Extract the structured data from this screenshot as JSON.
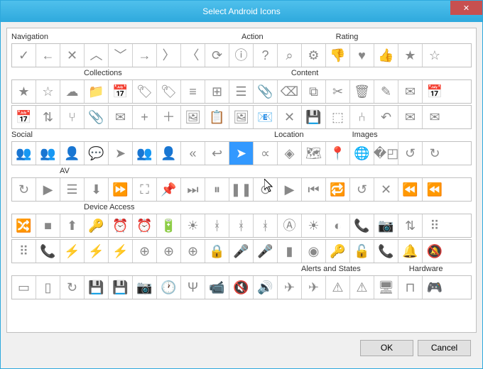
{
  "window": {
    "title": "Select Android Icons"
  },
  "buttons": {
    "ok": "OK",
    "cancel": "Cancel",
    "close": "✕"
  },
  "selected_icon": "social-send",
  "categories": [
    {
      "row": 0,
      "pos": 0,
      "label": "Navigation"
    },
    {
      "row": 0,
      "pos": 10,
      "label": "Action"
    },
    {
      "row": 0,
      "pos": 15,
      "label": "Rating"
    },
    {
      "row": 1,
      "pos": 3,
      "label": "Collections"
    },
    {
      "row": 1,
      "pos": 12,
      "label": "Content"
    },
    {
      "row": 3,
      "pos": 0,
      "label": "Social"
    },
    {
      "row": 3,
      "pos": 12,
      "label": "Location"
    },
    {
      "row": 3,
      "pos": 16,
      "label": "Images"
    },
    {
      "row": 4,
      "pos": 2,
      "label": "AV"
    },
    {
      "row": 5,
      "pos": 3,
      "label": "Device Access"
    },
    {
      "row": 7,
      "pos": 12,
      "label": "Alerts and States"
    },
    {
      "row": 7,
      "pos": 17,
      "label": "Hardware"
    }
  ],
  "rows": [
    [
      {
        "n": "nav-accept",
        "g": "✓"
      },
      {
        "n": "nav-back",
        "g": "←"
      },
      {
        "n": "nav-cancel",
        "g": "✕"
      },
      {
        "n": "nav-collapse",
        "g": "︿"
      },
      {
        "n": "nav-expand",
        "g": "﹀"
      },
      {
        "n": "nav-forward",
        "g": "→"
      },
      {
        "n": "nav-next",
        "g": "〉"
      },
      {
        "n": "nav-previous",
        "g": "〈"
      },
      {
        "n": "nav-refresh",
        "g": "⟳"
      },
      {
        "n": "action-about",
        "g": "ⓘ"
      },
      {
        "n": "action-help",
        "g": "?"
      },
      {
        "n": "action-search",
        "g": "⌕"
      },
      {
        "n": "action-settings",
        "g": "⚙"
      },
      {
        "n": "rating-bad",
        "g": "👎"
      },
      {
        "n": "rating-favorite",
        "g": "♥"
      },
      {
        "n": "rating-good",
        "g": "👍"
      },
      {
        "n": "rating-important",
        "g": "★"
      },
      {
        "n": "rating-half",
        "g": "☆"
      }
    ],
    [
      {
        "n": "rating-important2",
        "g": "★"
      },
      {
        "n": "rating-not-important",
        "g": "☆"
      },
      {
        "n": "collections-cloud",
        "g": "☁"
      },
      {
        "n": "collections-collection",
        "g": "📁"
      },
      {
        "n": "collections-go-today",
        "g": "📅"
      },
      {
        "n": "collections-labels",
        "g": "🏷"
      },
      {
        "n": "collections-new-label",
        "g": "🏷"
      },
      {
        "n": "collections-sort",
        "g": "≡"
      },
      {
        "n": "collections-view-grid",
        "g": "⊞"
      },
      {
        "n": "collections-view-list",
        "g": "☰"
      },
      {
        "n": "content-attachment",
        "g": "📎"
      },
      {
        "n": "content-backspace",
        "g": "⌫"
      },
      {
        "n": "content-copy",
        "g": "⧉"
      },
      {
        "n": "content-cut",
        "g": "✂"
      },
      {
        "n": "content-discard",
        "g": "🗑"
      },
      {
        "n": "content-edit",
        "g": "✎"
      },
      {
        "n": "content-email",
        "g": "✉"
      },
      {
        "n": "content-event",
        "g": "📅"
      }
    ],
    [
      {
        "n": "content-event2",
        "g": "📅"
      },
      {
        "n": "content-import-export",
        "g": "⇅"
      },
      {
        "n": "content-merge",
        "g": "⑂"
      },
      {
        "n": "content-attachment2",
        "g": "📎"
      },
      {
        "n": "content-email2",
        "g": "✉"
      },
      {
        "n": "content-add-person",
        "g": "+"
      },
      {
        "n": "content-new",
        "g": "＋"
      },
      {
        "n": "content-picture",
        "g": "🖼"
      },
      {
        "n": "content-paste",
        "g": "📋"
      },
      {
        "n": "content-picture2",
        "g": "🖼"
      },
      {
        "n": "content-read",
        "g": "📧"
      },
      {
        "n": "content-remove",
        "g": "✕"
      },
      {
        "n": "content-save",
        "g": "💾"
      },
      {
        "n": "content-select-all",
        "g": "⬚"
      },
      {
        "n": "content-split",
        "g": "⑃"
      },
      {
        "n": "content-undo",
        "g": "↶"
      },
      {
        "n": "content-unread",
        "g": "✉"
      },
      {
        "n": "content-markread",
        "g": "✉"
      }
    ],
    [
      {
        "n": "social-group",
        "g": "👥"
      },
      {
        "n": "social-add-group",
        "g": "👥"
      },
      {
        "n": "social-person",
        "g": "👤"
      },
      {
        "n": "social-cc",
        "g": "💬"
      },
      {
        "n": "social-forward",
        "g": "➤"
      },
      {
        "n": "social-group2",
        "g": "👥"
      },
      {
        "n": "social-person2",
        "g": "👤"
      },
      {
        "n": "social-reply-all",
        "g": "«"
      },
      {
        "n": "social-reply",
        "g": "↩"
      },
      {
        "n": "social-send",
        "g": "➤"
      },
      {
        "n": "social-share",
        "g": "∝"
      },
      {
        "n": "location-directions",
        "g": "◈"
      },
      {
        "n": "location-map",
        "g": "🗺"
      },
      {
        "n": "location-place",
        "g": "📍"
      },
      {
        "n": "location-web",
        "g": "🌐"
      },
      {
        "n": "images-crop",
        "g": "�◰"
      },
      {
        "n": "images-rotate-left",
        "g": "↺"
      },
      {
        "n": "images-rotate-right",
        "g": "↻"
      }
    ],
    [
      {
        "n": "av-rotate",
        "g": "↻"
      },
      {
        "n": "av-slideshow",
        "g": "▶"
      },
      {
        "n": "av-queue",
        "g": "☰"
      },
      {
        "n": "av-download",
        "g": "⬇"
      },
      {
        "n": "av-ff",
        "g": "⏩"
      },
      {
        "n": "av-fullscreen",
        "g": "⛶"
      },
      {
        "n": "av-available",
        "g": "📌"
      },
      {
        "n": "av-next",
        "g": "⏭"
      },
      {
        "n": "av-pause2",
        "g": "⏸"
      },
      {
        "n": "av-pause",
        "g": "❚❚"
      },
      {
        "n": "av-play-circle",
        "g": "⊙"
      },
      {
        "n": "av-play",
        "g": "▶"
      },
      {
        "n": "av-previous",
        "g": "⏮"
      },
      {
        "n": "av-repeat",
        "g": "🔁"
      },
      {
        "n": "av-replay",
        "g": "↺"
      },
      {
        "n": "av-return-fs",
        "g": "✕"
      },
      {
        "n": "av-rewind",
        "g": "⏪"
      },
      {
        "n": "av-rewind2",
        "g": "⏪"
      }
    ],
    [
      {
        "n": "av-shuffle",
        "g": "🔀"
      },
      {
        "n": "av-stop",
        "g": "■"
      },
      {
        "n": "av-upload",
        "g": "⬆"
      },
      {
        "n": "device-key",
        "g": "🔑"
      },
      {
        "n": "device-alarm-add",
        "g": "⏰"
      },
      {
        "n": "device-alarms",
        "g": "⏰"
      },
      {
        "n": "device-battery",
        "g": "🔋"
      },
      {
        "n": "device-bright-low",
        "g": "☀"
      },
      {
        "n": "device-bt-connected",
        "g": "ᚼ"
      },
      {
        "n": "device-bluetooth",
        "g": "ᚼ"
      },
      {
        "n": "device-bt-search",
        "g": "ᚼ"
      },
      {
        "n": "device-bright-auto",
        "g": "Ⓐ"
      },
      {
        "n": "device-bright-high",
        "g": "☀"
      },
      {
        "n": "device-bright-med",
        "g": "◐"
      },
      {
        "n": "device-call",
        "g": "📞"
      },
      {
        "n": "device-camera",
        "g": "📷"
      },
      {
        "n": "device-data",
        "g": "⇅"
      },
      {
        "n": "device-dial",
        "g": "⠿"
      }
    ],
    [
      {
        "n": "device-dialpad",
        "g": "⠿"
      },
      {
        "n": "device-end-call",
        "g": "📞"
      },
      {
        "n": "device-flash-auto",
        "g": "⚡"
      },
      {
        "n": "device-flash-off",
        "g": "⚡"
      },
      {
        "n": "device-flash-on",
        "g": "⚡"
      },
      {
        "n": "device-gps-found",
        "g": "⊕"
      },
      {
        "n": "device-gps-off",
        "g": "⊕"
      },
      {
        "n": "device-gps-search",
        "g": "⊕"
      },
      {
        "n": "device-secure",
        "g": "🔒"
      },
      {
        "n": "device-mic",
        "g": "🎤"
      },
      {
        "n": "device-mic-mute",
        "g": "🎤"
      },
      {
        "n": "device-cell",
        "g": "▮"
      },
      {
        "n": "device-wifi",
        "g": "◉"
      },
      {
        "n": "device-new-account",
        "g": "🔑"
      },
      {
        "n": "device-not-secure",
        "g": "🔓"
      },
      {
        "n": "device-call2",
        "g": "📞"
      },
      {
        "n": "device-ring",
        "g": "🔔"
      },
      {
        "n": "device-ring-silent",
        "g": "🔕"
      }
    ],
    [
      {
        "n": "device-screen-lock",
        "g": "▭"
      },
      {
        "n": "device-screen-port",
        "g": "▯"
      },
      {
        "n": "device-screen-rot",
        "g": "↻"
      },
      {
        "n": "device-sd",
        "g": "💾"
      },
      {
        "n": "device-storage",
        "g": "💾"
      },
      {
        "n": "device-camera2",
        "g": "📷"
      },
      {
        "n": "device-time",
        "g": "🕐"
      },
      {
        "n": "device-usb",
        "g": "Ψ"
      },
      {
        "n": "device-video",
        "g": "📹"
      },
      {
        "n": "device-volume",
        "g": "🔇"
      },
      {
        "n": "device-vol-on",
        "g": "🔊"
      },
      {
        "n": "alerts-airplane-off",
        "g": "✈"
      },
      {
        "n": "alerts-airplane-on",
        "g": "✈"
      },
      {
        "n": "alerts-error",
        "g": "⚠"
      },
      {
        "n": "alerts-warning",
        "g": "⚠"
      },
      {
        "n": "hw-computer",
        "g": "🖥"
      },
      {
        "n": "hw-dock",
        "g": "⊓"
      },
      {
        "n": "hw-gamepad",
        "g": "🎮"
      }
    ]
  ]
}
